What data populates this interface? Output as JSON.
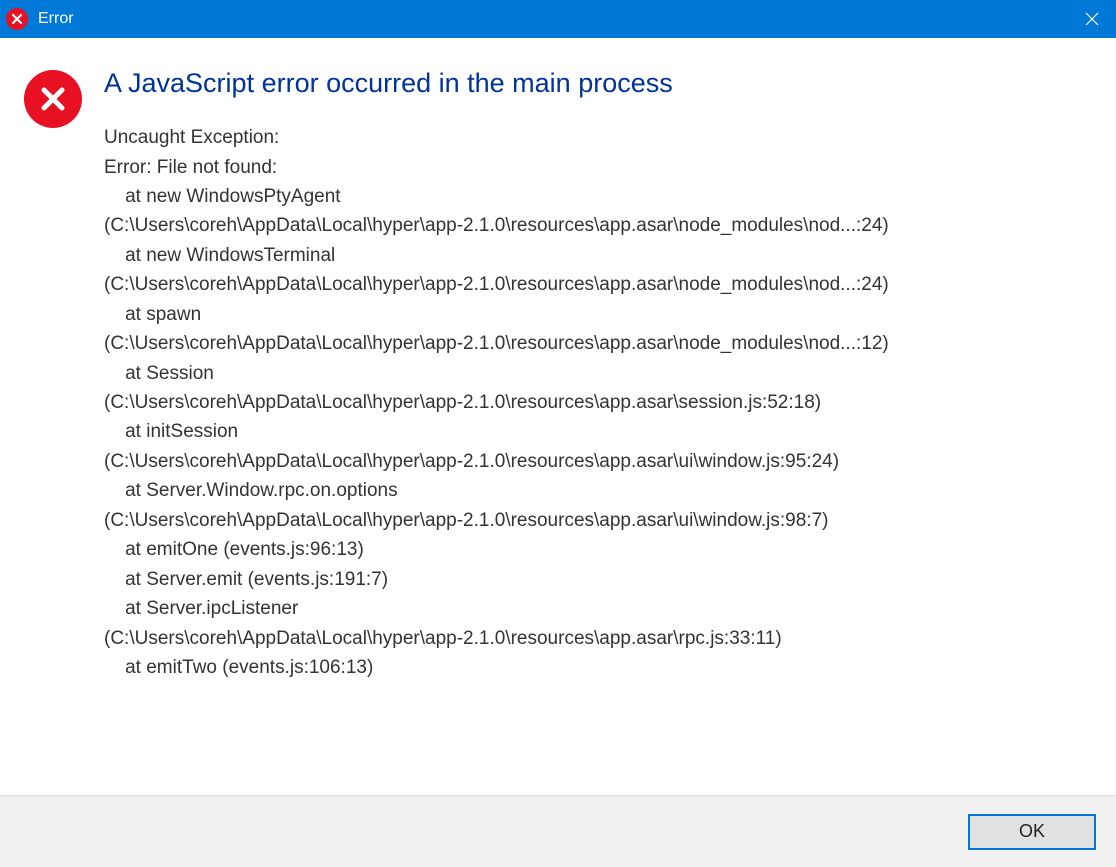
{
  "titlebar": {
    "title": "Error"
  },
  "dialog": {
    "mainInstruction": "A JavaScript error occurred in the main process",
    "bodyText": "Uncaught Exception:\nError: File not found:\n    at new WindowsPtyAgent\n(C:\\Users\\coreh\\AppData\\Local\\hyper\\app-2.1.0\\resources\\app.asar\\node_modules\\nod...:24)\n    at new WindowsTerminal\n(C:\\Users\\coreh\\AppData\\Local\\hyper\\app-2.1.0\\resources\\app.asar\\node_modules\\nod...:24)\n    at spawn\n(C:\\Users\\coreh\\AppData\\Local\\hyper\\app-2.1.0\\resources\\app.asar\\node_modules\\nod...:12)\n    at Session\n(C:\\Users\\coreh\\AppData\\Local\\hyper\\app-2.1.0\\resources\\app.asar\\session.js:52:18)\n    at initSession\n(C:\\Users\\coreh\\AppData\\Local\\hyper\\app-2.1.0\\resources\\app.asar\\ui\\window.js:95:24)\n    at Server.Window.rpc.on.options\n(C:\\Users\\coreh\\AppData\\Local\\hyper\\app-2.1.0\\resources\\app.asar\\ui\\window.js:98:7)\n    at emitOne (events.js:96:13)\n    at Server.emit (events.js:191:7)\n    at Server.ipcListener\n(C:\\Users\\coreh\\AppData\\Local\\hyper\\app-2.1.0\\resources\\app.asar\\rpc.js:33:11)\n    at emitTwo (events.js:106:13)"
  },
  "footer": {
    "okLabel": "OK"
  }
}
